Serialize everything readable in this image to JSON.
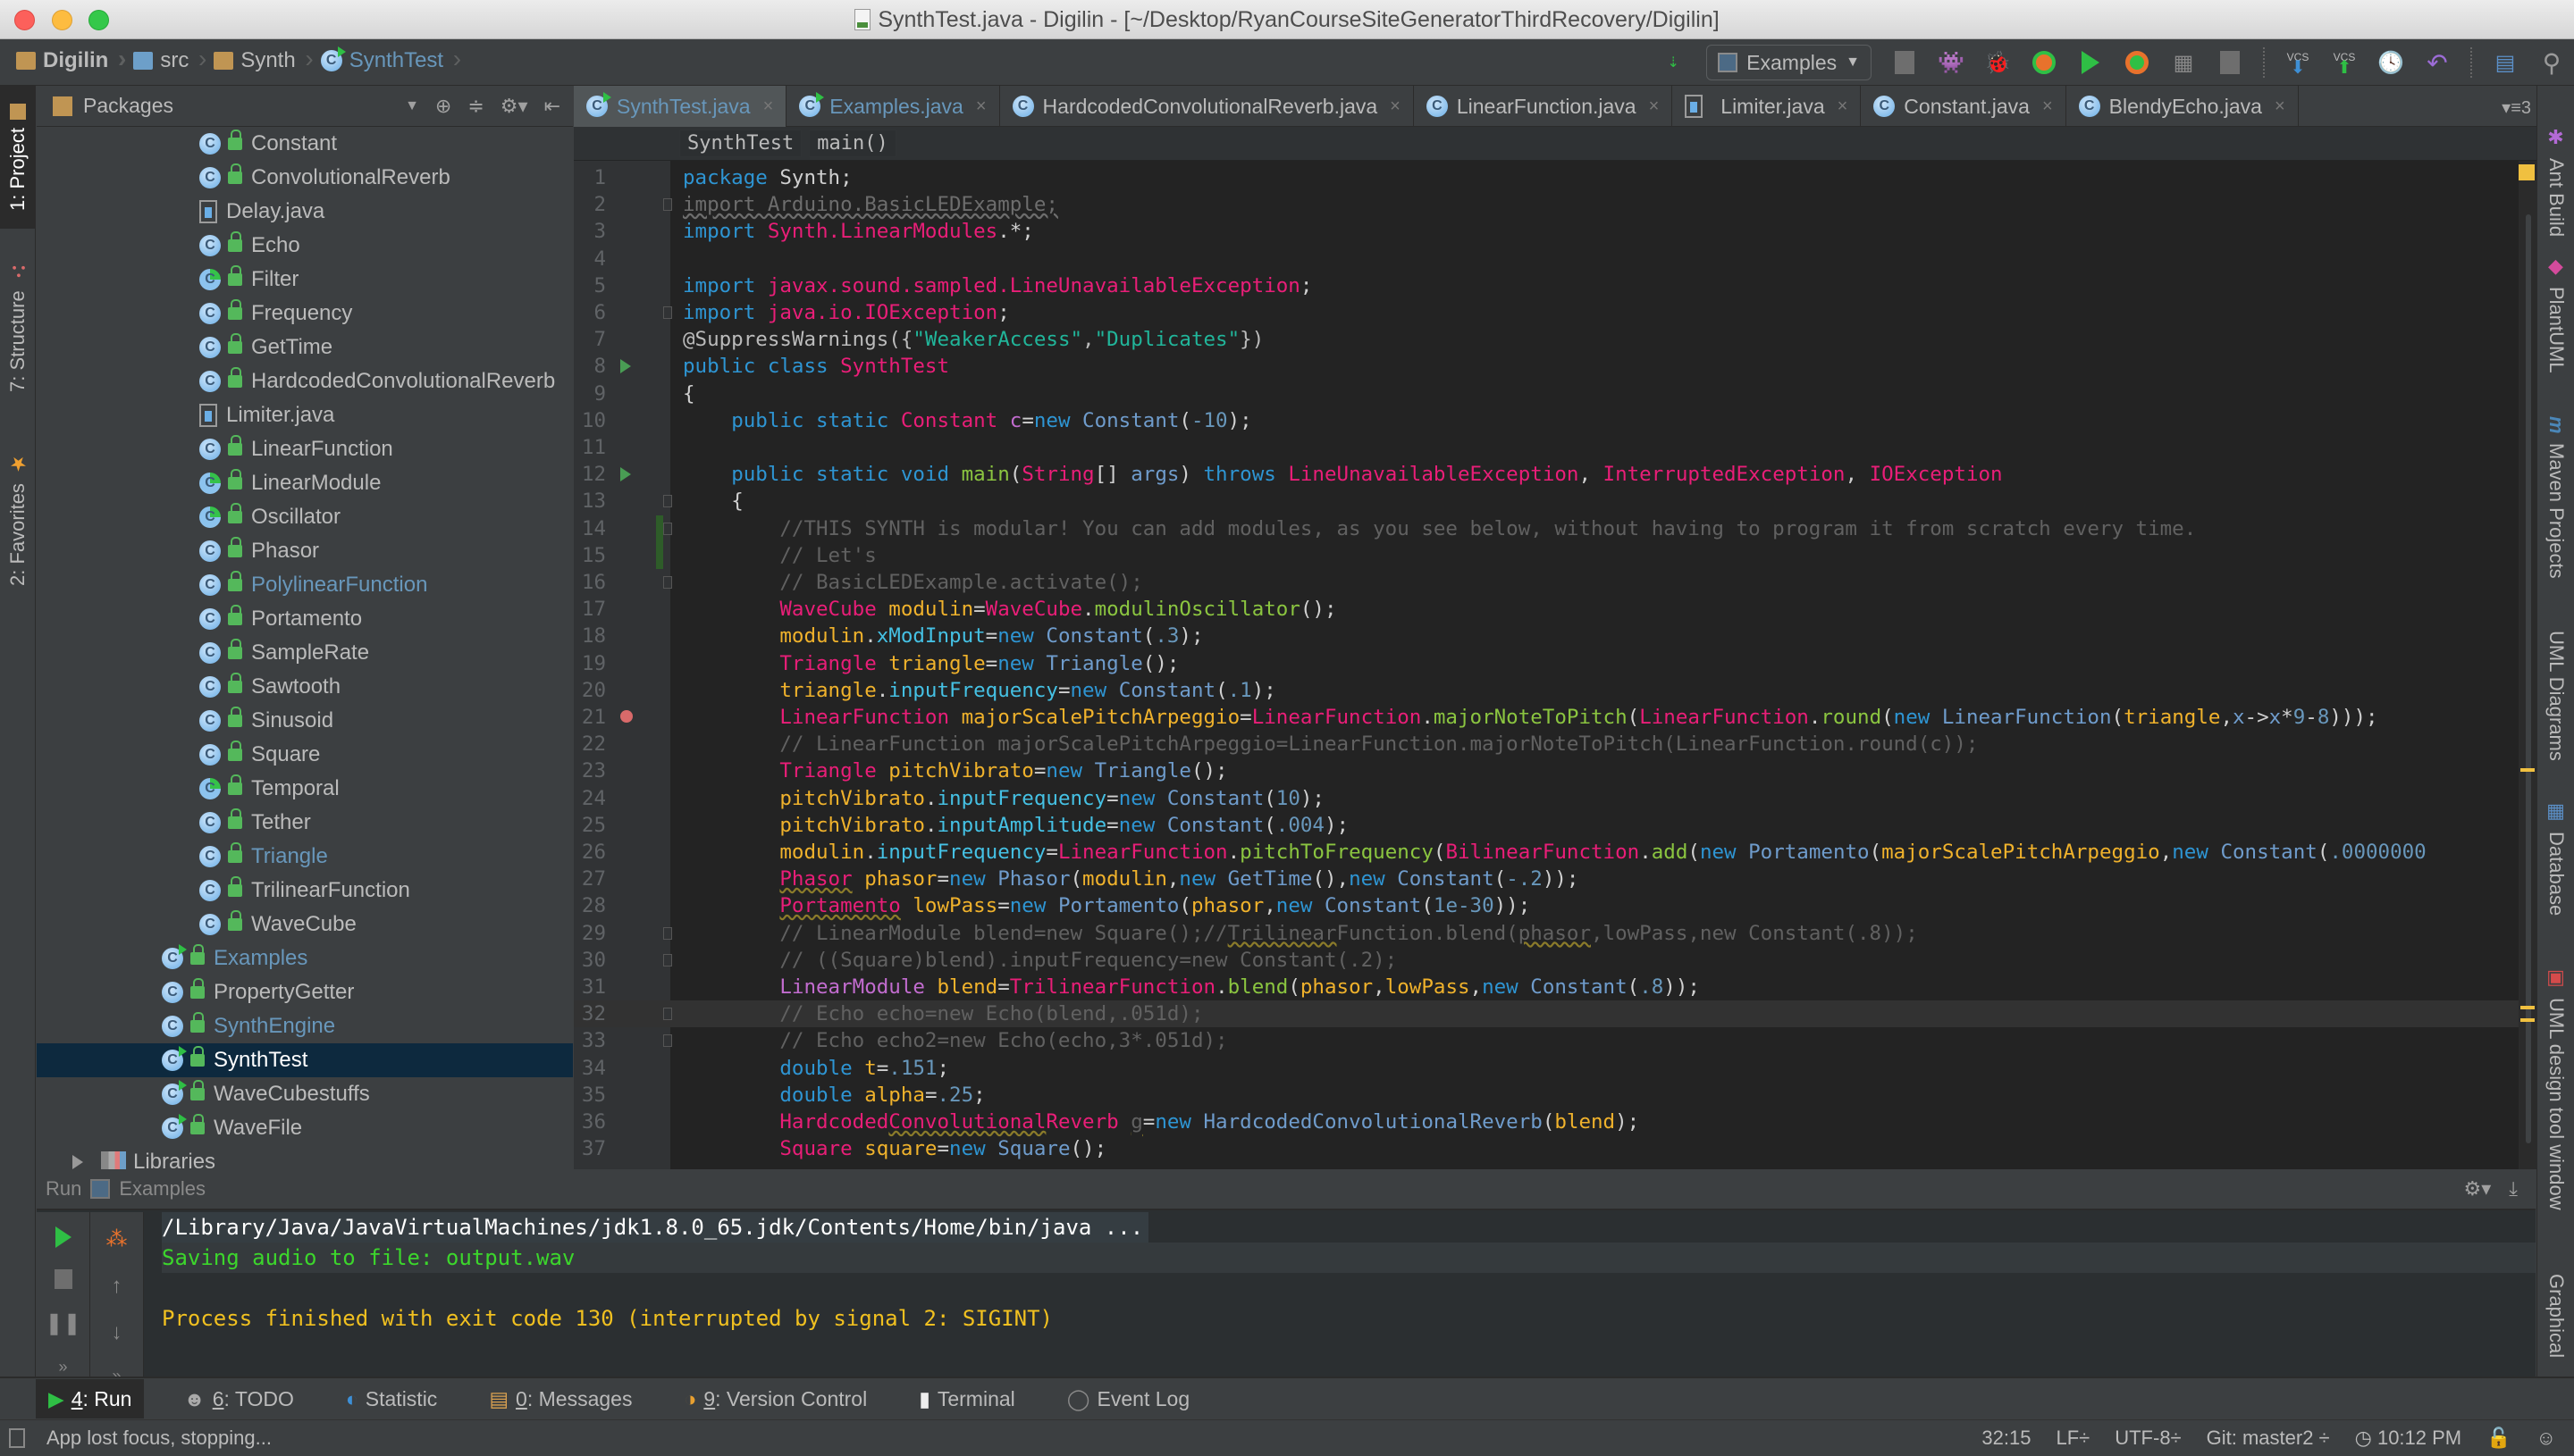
{
  "window": {
    "title": "SynthTest.java - Digilin - [~/Desktop/RyanCourseSiteGeneratorThirdRecovery/Digilin]"
  },
  "breadcrumbs": [
    {
      "label": "Digilin",
      "icon": "project-folder-icon"
    },
    {
      "label": "src",
      "icon": "source-folder-icon"
    },
    {
      "label": "Synth",
      "icon": "package-folder-icon"
    },
    {
      "label": "SynthTest",
      "icon": "runnable-class-icon"
    }
  ],
  "toolbar": {
    "run_config": "Examples",
    "icons": [
      "build-icon",
      "stop-icon",
      "android-icon",
      "debug-icon",
      "coverage-icon",
      "run-icon",
      "profile-icon",
      "concurrency-icon",
      "stop-all-icon",
      "vcs-update-icon",
      "vcs-commit-icon",
      "history-icon",
      "revert-icon",
      "structure-icon",
      "search-icon"
    ],
    "vcs_update": "VCS",
    "vcs_commit": "VCS"
  },
  "left_stripe": {
    "tabs": [
      {
        "label": "1: Project",
        "active": true
      },
      {
        "label": "7: Structure",
        "active": false
      },
      {
        "label": "2: Favorites",
        "active": false
      }
    ]
  },
  "project_panel": {
    "view": "Packages",
    "tree": [
      {
        "name": "Constant",
        "type": "class",
        "level": 2
      },
      {
        "name": "ConvolutionalReverb",
        "type": "class",
        "level": 2
      },
      {
        "name": "Delay.java",
        "type": "file",
        "level": 2
      },
      {
        "name": "Echo",
        "type": "class",
        "level": 2
      },
      {
        "name": "Filter",
        "type": "abstract",
        "level": 2
      },
      {
        "name": "Frequency",
        "type": "class",
        "level": 2
      },
      {
        "name": "GetTime",
        "type": "class",
        "level": 2
      },
      {
        "name": "HardcodedConvolutionalReverb",
        "type": "class",
        "level": 2
      },
      {
        "name": "Limiter.java",
        "type": "file",
        "level": 2
      },
      {
        "name": "LinearFunction",
        "type": "class",
        "level": 2
      },
      {
        "name": "LinearModule",
        "type": "abstract",
        "level": 2
      },
      {
        "name": "Oscillator",
        "type": "abstract",
        "level": 2
      },
      {
        "name": "Phasor",
        "type": "class",
        "level": 2
      },
      {
        "name": "PolylinearFunction",
        "type": "class",
        "level": 2,
        "modified": true
      },
      {
        "name": "Portamento",
        "type": "class",
        "level": 2
      },
      {
        "name": "SampleRate",
        "type": "class",
        "level": 2
      },
      {
        "name": "Sawtooth",
        "type": "class",
        "level": 2
      },
      {
        "name": "Sinusoid",
        "type": "class",
        "level": 2
      },
      {
        "name": "Square",
        "type": "class",
        "level": 2
      },
      {
        "name": "Temporal",
        "type": "abstract",
        "level": 2
      },
      {
        "name": "Tether",
        "type": "class",
        "level": 2
      },
      {
        "name": "Triangle",
        "type": "class",
        "level": 2,
        "modified": true
      },
      {
        "name": "TrilinearFunction",
        "type": "class",
        "level": 2
      },
      {
        "name": "WaveCube",
        "type": "class",
        "level": 2
      },
      {
        "name": "Examples",
        "type": "runnable",
        "level": 1,
        "modified": true
      },
      {
        "name": "PropertyGetter",
        "type": "class",
        "level": 1
      },
      {
        "name": "SynthEngine",
        "type": "class",
        "level": 1,
        "modified": true
      },
      {
        "name": "SynthTest",
        "type": "runnable",
        "level": 1,
        "selected": true
      },
      {
        "name": "WaveCubestuffs",
        "type": "runnable",
        "level": 1
      },
      {
        "name": "WaveFile",
        "type": "runnable",
        "level": 1
      },
      {
        "name": "Libraries",
        "type": "libraries",
        "level": 0
      }
    ]
  },
  "editor": {
    "tabs": [
      {
        "label": "SynthTest.java",
        "icon": "runnable",
        "active": true,
        "modified": true
      },
      {
        "label": "Examples.java",
        "icon": "runnable",
        "active": false,
        "modified": true
      },
      {
        "label": "HardcodedConvolutionalReverb.java",
        "icon": "class",
        "active": false
      },
      {
        "label": "LinearFunction.java",
        "icon": "class",
        "active": false
      },
      {
        "label": "Limiter.java",
        "icon": "file",
        "active": false
      },
      {
        "label": "Constant.java",
        "icon": "class",
        "active": false
      },
      {
        "label": "BlendyEcho.java",
        "icon": "class",
        "active": false
      }
    ],
    "tab_overflow": "3",
    "code_breadcrumb": [
      "SynthTest",
      "main()"
    ],
    "current_line": 32,
    "lines": [
      {
        "n": 1,
        "html": "<span class='kw'>package</span> <span class='pu'>Synth;</span>"
      },
      {
        "n": 2,
        "html": "<span class='dim'>import Arduino.BasicLEDExample;</span>"
      },
      {
        "n": 3,
        "html": "<span class='kw'>import</span> <span class='ty'>Synth.LinearModules</span><span class='pu'>.*;</span>"
      },
      {
        "n": 4,
        "html": ""
      },
      {
        "n": 5,
        "html": "<span class='kw'>import</span> <span class='ty'>javax.sound.sampled.LineUnavailableException</span><span class='pu'>;</span>"
      },
      {
        "n": 6,
        "html": "<span class='kw'>import</span> <span class='ty'>java.io.IOException</span><span class='pu'>;</span>"
      },
      {
        "n": 7,
        "html": "<span class='ann'>@SuppressWarnings({</span><span class='str'>\"WeakerAccess\"</span><span class='ann'>,</span><span class='str'>\"Duplicates\"</span><span class='ann'>})</span>"
      },
      {
        "n": 8,
        "html": "<span class='kw'>public class</span> <span class='ty'>SynthTest</span>"
      },
      {
        "n": 9,
        "html": "<span class='pu'>{</span>"
      },
      {
        "n": 10,
        "html": "    <span class='kw'>public static</span> <span class='ty'>Constant</span> <span class='purple'>c</span><span class='pu'>=</span><span class='kw'>new</span> <span class='ctor'>Constant</span><span class='pu'>(</span><span class='num'>-10</span><span class='pu'>);</span>"
      },
      {
        "n": 11,
        "html": ""
      },
      {
        "n": 12,
        "html": "    <span class='kw'>public static void</span> <span class='fn'>main</span><span class='pu'>(</span><span class='ty'>String</span><span class='pu'>[]</span> <span class='ctor'>args</span><span class='pu'>)</span> <span class='kw'>throws</span> <span class='ty'>LineUnavailableException</span><span class='pu'>,</span> <span class='ty'>InterruptedException</span><span class='pu'>,</span> <span class='ty'>IOException</span>"
      },
      {
        "n": 13,
        "html": "    <span class='pu'>{</span>"
      },
      {
        "n": 14,
        "html": "        <span class='cm'>//THIS SYNTH is modular! You can add modules, as you see below, without having to program it from scratch every time.</span>"
      },
      {
        "n": 15,
        "html": "        <span class='cm'>// Let's</span>"
      },
      {
        "n": 16,
        "html": "        <span class='cm'>// BasicLEDExample.activate();</span>"
      },
      {
        "n": 17,
        "html": "        <span class='ty'>WaveCube</span> <span class='var'>modulin</span><span class='pu'>=</span><span class='ty'>WaveCube</span><span class='pu'>.</span><span class='fn'>modulinOscillator</span><span class='pu'>();</span>"
      },
      {
        "n": 18,
        "html": "        <span class='var'>modulin</span><span class='pu'>.</span><span class='fld'>xModInput</span><span class='pu'>=</span><span class='kw'>new</span> <span class='ctor'>Constant</span><span class='pu'>(</span><span class='num'>.3</span><span class='pu'>);</span>"
      },
      {
        "n": 19,
        "html": "        <span class='ty'>Triangle</span> <span class='var'>triangle</span><span class='pu'>=</span><span class='kw'>new</span> <span class='ctor'>Triangle</span><span class='pu'>();</span>"
      },
      {
        "n": 20,
        "html": "        <span class='var'>triangle</span><span class='pu'>.</span><span class='fld'>inputFrequency</span><span class='pu'>=</span><span class='kw'>new</span> <span class='ctor'>Constant</span><span class='pu'>(</span><span class='num'>.1</span><span class='pu'>);</span>"
      },
      {
        "n": 21,
        "html": "        <span class='ty'>LinearFunction</span> <span class='var'>majorScalePitchArpeggio</span><span class='pu'>=</span><span class='ty'>LinearFunction</span><span class='pu'>.</span><span class='fn'>majorNoteToPitch</span><span class='pu'>(</span><span class='ty'>LinearFunction</span><span class='pu'>.</span><span class='fn'>round</span><span class='pu'>(</span><span class='kw'>new</span> <span class='ctor'>LinearFunction</span><span class='pu'>(</span><span class='var'>triangle</span><span class='pu'>,</span><span class='ctor'>x</span><span class='pu'>-></span><span class='ctor'>x</span><span class='pu'>*</span><span class='num'>9</span><span class='pu'>-</span><span class='num'>8</span><span class='pu'>)));</span>"
      },
      {
        "n": 22,
        "html": "        <span class='cm'>// LinearFunction majorScalePitchArpeggio=LinearFunction.majorNoteToPitch(LinearFunction.round(c));</span>"
      },
      {
        "n": 23,
        "html": "        <span class='ty'>Triangle</span> <span class='var'>pitchVibrato</span><span class='pu'>=</span><span class='kw'>new</span> <span class='ctor'>Triangle</span><span class='pu'>();</span>"
      },
      {
        "n": 24,
        "html": "        <span class='var'>pitchVibrato</span><span class='pu'>.</span><span class='fld'>inputFrequency</span><span class='pu'>=</span><span class='kw'>new</span> <span class='ctor'>Constant</span><span class='pu'>(</span><span class='num'>10</span><span class='pu'>);</span>"
      },
      {
        "n": 25,
        "html": "        <span class='var'>pitchVibrato</span><span class='pu'>.</span><span class='fld'>inputAmplitude</span><span class='pu'>=</span><span class='kw'>new</span> <span class='ctor'>Constant</span><span class='pu'>(</span><span class='num'>.004</span><span class='pu'>);</span>"
      },
      {
        "n": 26,
        "html": "        <span class='var'>modulin</span><span class='pu'>.</span><span class='fld'>inputFrequency</span><span class='pu'>=</span><span class='ty'>LinearFunction</span><span class='pu'>.</span><span class='fn'>pitchToFrequency</span><span class='pu'>(</span><span class='ty'>BilinearFunction</span><span class='pu'>.</span><span class='fn'>add</span><span class='pu'>(</span><span class='kw'>new</span> <span class='ctor'>Portamento</span><span class='pu'>(</span><span class='var'>majorScalePitchArpeggio</span><span class='pu'>,</span><span class='kw'>new</span> <span class='ctor'>Constant</span><span class='pu'>(</span><span class='num'>.0000000</span>"
      },
      {
        "n": 27,
        "html": "        <span class='ty warn'>Phasor</span> <span class='var'>phasor</span><span class='pu'>=</span><span class='kw'>new</span> <span class='ctor'>Phasor</span><span class='pu'>(</span><span class='var'>modulin</span><span class='pu'>,</span><span class='kw'>new</span> <span class='ctor'>GetTime</span><span class='pu'>(),</span><span class='kw'>new</span> <span class='ctor'>Constant</span><span class='pu'>(</span><span class='num'>-.2</span><span class='pu'>));</span>"
      },
      {
        "n": 28,
        "html": "        <span class='ty warn'>Portamento</span> <span class='var'>lowPass</span><span class='pu'>=</span><span class='kw'>new</span> <span class='ctor'>Portamento</span><span class='pu'>(</span><span class='var'>phasor</span><span class='pu'>,</span><span class='kw'>new</span> <span class='ctor'>Constant</span><span class='pu'>(</span><span class='num'>1e-30</span><span class='pu'>));</span>"
      },
      {
        "n": 29,
        "html": "        <span class='cm'>// LinearModule blend=new Square();//<span class='warn'>Trilinear</span>Function.blend(<span class='warn'>phasor</span>,lowPass,new Constant(.8));</span>"
      },
      {
        "n": 30,
        "html": "        <span class='cm'>// ((Square)blend).inputFrequency=new Constant(.2);</span>"
      },
      {
        "n": 31,
        "html": "        <span class='purple'>LinearModule</span> <span class='var'>blend</span><span class='pu'>=</span><span class='ty'>TrilinearFunction</span><span class='pu'>.</span><span class='fn'>blend</span><span class='pu'>(</span><span class='var'>phasor</span><span class='pu'>,</span><span class='var'>lowPass</span><span class='pu'>,</span><span class='kw'>new</span> <span class='ctor'>Constant</span><span class='pu'>(</span><span class='num'>.8</span><span class='pu'>));</span>"
      },
      {
        "n": 32,
        "html": "        <span class='cm'>// Echo echo=new Echo(blend,.051d);</span>"
      },
      {
        "n": 33,
        "html": "        <span class='cm'>// Echo echo2=new Echo(echo,3*.051d);</span>"
      },
      {
        "n": 34,
        "html": "        <span class='kw'>double</span> <span class='var'>t</span><span class='pu'>=</span><span class='num'>.151</span><span class='pu'>;</span>"
      },
      {
        "n": 35,
        "html": "        <span class='kw'>double</span> <span class='var'>alpha</span><span class='pu'>=</span><span class='num'>.25</span><span class='pu'>;</span>"
      },
      {
        "n": 36,
        "html": "        <span class='ty'>Hardcoded<span class='warn'>Convolutional</span>Reverb</span> <span class='cm warn'>g</span><span class='pu'>=</span><span class='kw'>new</span> <span class='ctor'>HardcodedConvolutionalReverb</span><span class='pu'>(</span><span class='var'>blend</span><span class='pu'>);</span>"
      },
      {
        "n": 37,
        "html": "        <span class='ty'>Square</span> <span class='var'>square</span><span class='pu'>=</span><span class='kw'>new</span> <span class='ctor'>Square</span><span class='pu'>();</span>"
      }
    ]
  },
  "right_stripe": {
    "tabs": [
      "Ant Build",
      "PlantUML",
      "Maven Projects",
      "UML Diagrams",
      "Database",
      "UML design tool window",
      "Graphical"
    ]
  },
  "run_panel": {
    "title": "Run",
    "config": "Examples",
    "console": [
      {
        "text": "/Library/Java/JavaVirtualMachines/jdk1.8.0_65.jdk/Contents/Home/bin/java ...",
        "style": "cmd"
      },
      {
        "text": "Saving audio to file: output.wav",
        "style": "green"
      },
      {
        "text": "",
        "style": "plain"
      },
      {
        "text": "Process finished with exit code 130 (interrupted by signal 2: SIGINT)",
        "style": "yellow"
      }
    ]
  },
  "bottom_tabs": [
    {
      "key": "4",
      "label": ": Run",
      "active": true
    },
    {
      "key": "6",
      "label": ": TODO",
      "active": false
    },
    {
      "key": "",
      "label": "Statistic",
      "active": false
    },
    {
      "key": "0",
      "label": ": Messages",
      "active": false
    },
    {
      "key": "9",
      "label": ": Version Control",
      "active": false
    },
    {
      "key": "",
      "label": "Terminal",
      "active": false
    },
    {
      "key": "",
      "label": "Event Log",
      "active": false
    }
  ],
  "status_bar": {
    "message": "App lost focus, stopping...",
    "position": "32:15",
    "line_sep": "LF÷",
    "encoding": "UTF-8÷",
    "vcs": "Git: master2 ÷",
    "time": "10:12 PM"
  },
  "colors": {
    "accent_blue": "#6897bb",
    "selection": "#0d293e",
    "run_green": "#499c54",
    "console_green": "#3cd62c",
    "console_yellow": "#f0c020"
  }
}
